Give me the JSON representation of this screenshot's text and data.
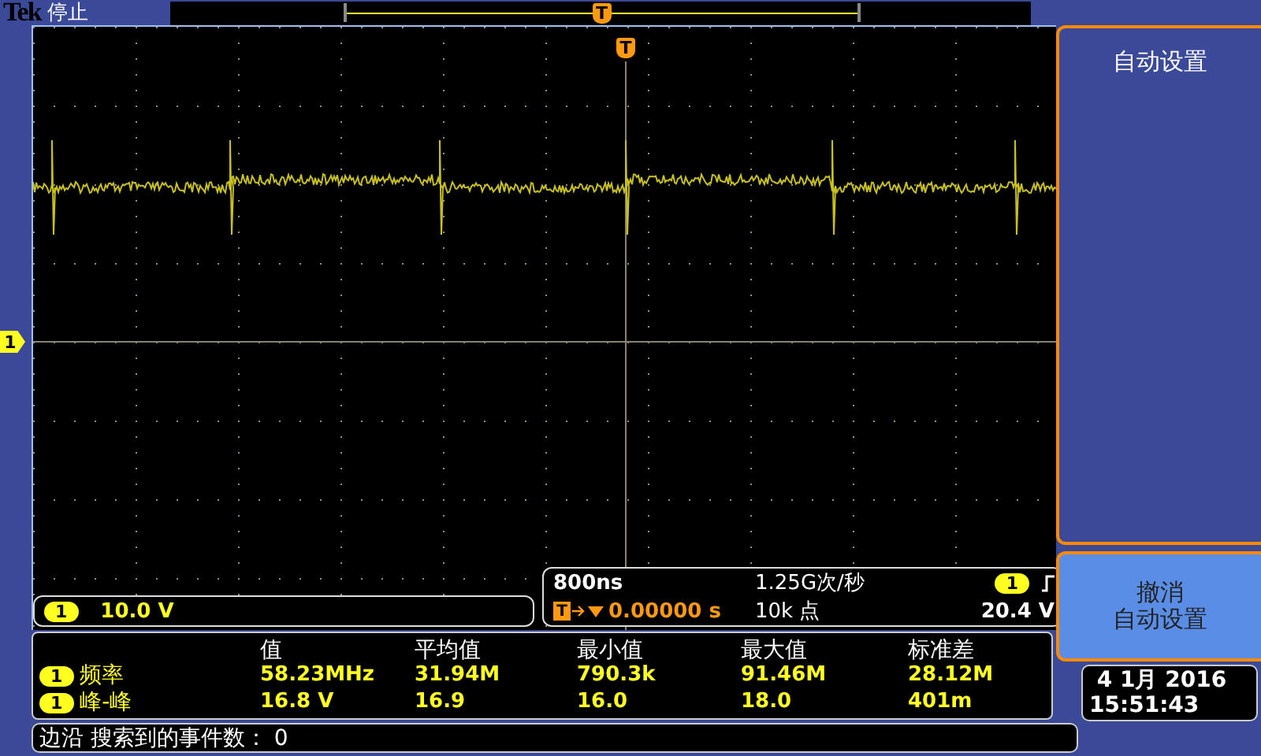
{
  "status": {
    "brand": "Tek",
    "state": "停止"
  },
  "record_view": {
    "trigger_marker": "T"
  },
  "graticule": {
    "trigger_marker": "T",
    "channel_marker": "1"
  },
  "channel_scale": {
    "channel": "1",
    "value": "10.0 V"
  },
  "horizontal": {
    "timebase": "800ns",
    "sample_rate": "1.25G次/秒",
    "trigger_channel": "1",
    "delay_marker": "T",
    "delay": "0.00000 s",
    "record_length": "10k 点",
    "trigger_level": "20.4 V"
  },
  "measurements": {
    "headers": [
      "值",
      "平均值",
      "最小值",
      "最大值",
      "标准差"
    ],
    "rows": [
      {
        "channel": "1",
        "name": "频率",
        "values": [
          "58.23MHz",
          "31.94M",
          "790.3k",
          "91.46M",
          "28.12M"
        ]
      },
      {
        "channel": "1",
        "name": "峰-峰",
        "values": [
          "16.8 V",
          "16.9",
          "16.0",
          "18.0",
          "401m"
        ]
      }
    ]
  },
  "search_status": "边沿 搜索到的事件数： 0",
  "side_menu": {
    "title": "自动设置",
    "buttons": [
      {
        "lines": [
          "撤消",
          "自动设置"
        ]
      }
    ]
  },
  "datetime": {
    "date": "4 1月 2016",
    "time": "15:51:43"
  }
}
